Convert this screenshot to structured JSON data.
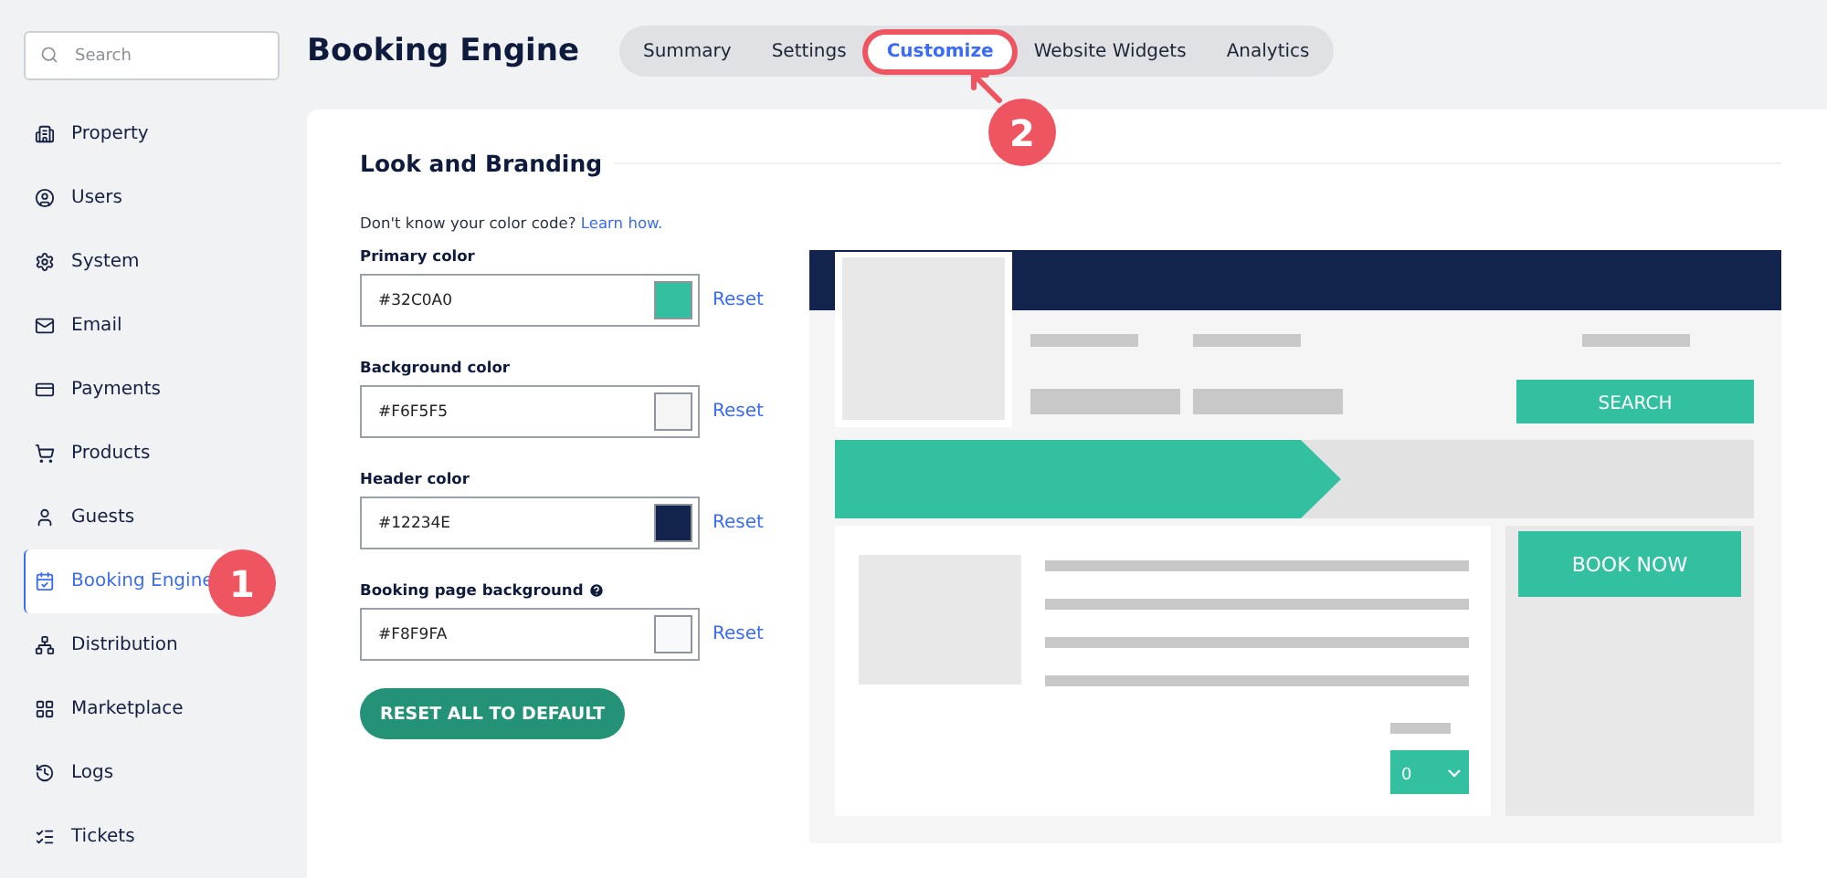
{
  "sidebar": {
    "search": {
      "placeholder": "Search"
    },
    "items": [
      {
        "label": "Property",
        "selected": false
      },
      {
        "label": "Users",
        "selected": false
      },
      {
        "label": "System",
        "selected": false
      },
      {
        "label": "Email",
        "selected": false
      },
      {
        "label": "Payments",
        "selected": false
      },
      {
        "label": "Products",
        "selected": false
      },
      {
        "label": "Guests",
        "selected": false
      },
      {
        "label": "Booking Engine",
        "selected": true
      },
      {
        "label": "Distribution",
        "selected": false
      },
      {
        "label": "Marketplace",
        "selected": false
      },
      {
        "label": "Logs",
        "selected": false
      },
      {
        "label": "Tickets",
        "selected": false
      }
    ]
  },
  "header": {
    "title": "Booking Engine",
    "tabs": [
      {
        "label": "Summary",
        "selected": false,
        "highlighted": false
      },
      {
        "label": "Settings",
        "selected": false,
        "highlighted": false
      },
      {
        "label": "Customize",
        "selected": true,
        "highlighted": true
      },
      {
        "label": "Website Widgets",
        "selected": false,
        "highlighted": false
      },
      {
        "label": "Analytics",
        "selected": false,
        "highlighted": false
      }
    ]
  },
  "annotations": [
    {
      "label": "1"
    },
    {
      "label": "2"
    }
  ],
  "branding": {
    "title": "Look and Branding",
    "hint": "Don't know your color code?",
    "hint_link": "Learn how.",
    "fields": [
      {
        "label": "Primary color",
        "value": "#32C0A0",
        "reset": "Reset",
        "help": false
      },
      {
        "label": "Background color",
        "value": "#F6F5F5",
        "reset": "Reset",
        "help": false
      },
      {
        "label": "Header color",
        "value": "#12234E",
        "reset": "Reset",
        "help": false
      },
      {
        "label": "Booking page background",
        "value": "#F8F9FA",
        "reset": "Reset",
        "help": true
      }
    ],
    "reset_all": "RESET ALL TO DEFAULT"
  },
  "preview": {
    "search_button": "SEARCH",
    "book_button": "BOOK NOW",
    "quantity": "0"
  }
}
